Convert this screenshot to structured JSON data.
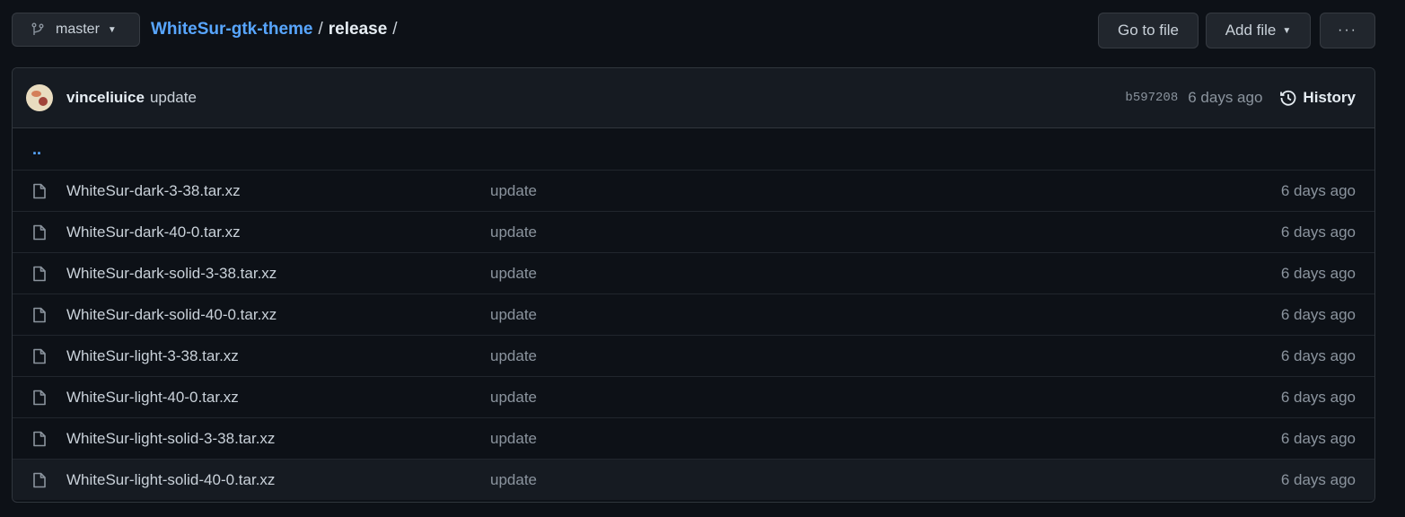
{
  "topbar": {
    "branch": "master",
    "repo": "WhiteSur-gtk-theme",
    "dir": "release",
    "sep": "/",
    "go_to_file": "Go to file",
    "add_file": "Add file",
    "more": "···"
  },
  "commit": {
    "author": "vinceliuice",
    "message": "update",
    "sha": "b597208",
    "age": "6 days ago",
    "history": "History"
  },
  "parent_dir": "..",
  "files": [
    {
      "name": "WhiteSur-dark-3-38.tar.xz",
      "message": "update",
      "age": "6 days ago"
    },
    {
      "name": "WhiteSur-dark-40-0.tar.xz",
      "message": "update",
      "age": "6 days ago"
    },
    {
      "name": "WhiteSur-dark-solid-3-38.tar.xz",
      "message": "update",
      "age": "6 days ago"
    },
    {
      "name": "WhiteSur-dark-solid-40-0.tar.xz",
      "message": "update",
      "age": "6 days ago"
    },
    {
      "name": "WhiteSur-light-3-38.tar.xz",
      "message": "update",
      "age": "6 days ago"
    },
    {
      "name": "WhiteSur-light-40-0.tar.xz",
      "message": "update",
      "age": "6 days ago"
    },
    {
      "name": "WhiteSur-light-solid-3-38.tar.xz",
      "message": "update",
      "age": "6 days ago"
    },
    {
      "name": "WhiteSur-light-solid-40-0.tar.xz",
      "message": "update",
      "age": "6 days ago"
    }
  ],
  "colors": {
    "background": "#0d1117",
    "link": "#58a6ff",
    "muted": "#8b949e"
  }
}
